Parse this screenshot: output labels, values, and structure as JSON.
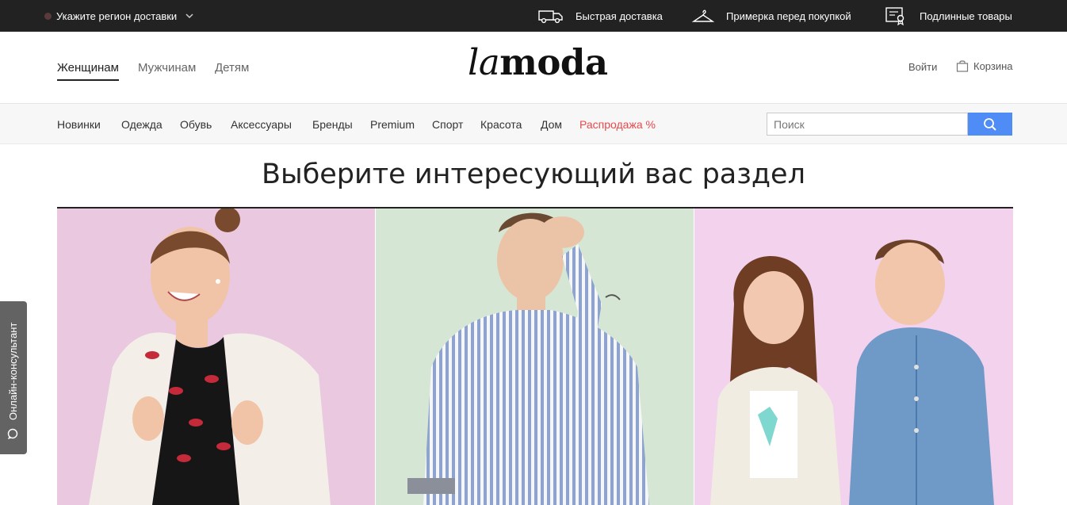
{
  "topbar": {
    "region_label": "Укажите регион доставки",
    "perks": [
      {
        "icon": "delivery-truck-icon",
        "label": "Быстрая доставка"
      },
      {
        "icon": "hanger-icon",
        "label": "Примерка перед покупкой"
      },
      {
        "icon": "certificate-icon",
        "label": "Подлинные товары"
      }
    ]
  },
  "header": {
    "genders": [
      "Женщинам",
      "Мужчинам",
      "Детям"
    ],
    "active_gender": "Женщинам",
    "logo": {
      "la": "la",
      "moda": "moda"
    },
    "login": "Войти",
    "cart": "Корзина"
  },
  "nav": {
    "items": [
      "Новинки",
      "Одежда",
      "Обувь",
      "Аксессуары",
      "Бренды",
      "Premium",
      "Спорт",
      "Красота",
      "Дом"
    ],
    "sale": "Распродажа %",
    "search_placeholder": "Поиск"
  },
  "main": {
    "heading": "Выберите интересующий вас раздел",
    "sections": [
      {
        "name": "women",
        "bg": "#e9c8e0"
      },
      {
        "name": "men",
        "bg": "#d6e6d4"
      },
      {
        "name": "kids",
        "bg": "#f2d2ec"
      }
    ]
  },
  "consultant": {
    "label": "Онлайн-консультант"
  },
  "colors": {
    "accent": "#4f8cf5",
    "sale": "#e8494a",
    "topbar": "#222222"
  }
}
